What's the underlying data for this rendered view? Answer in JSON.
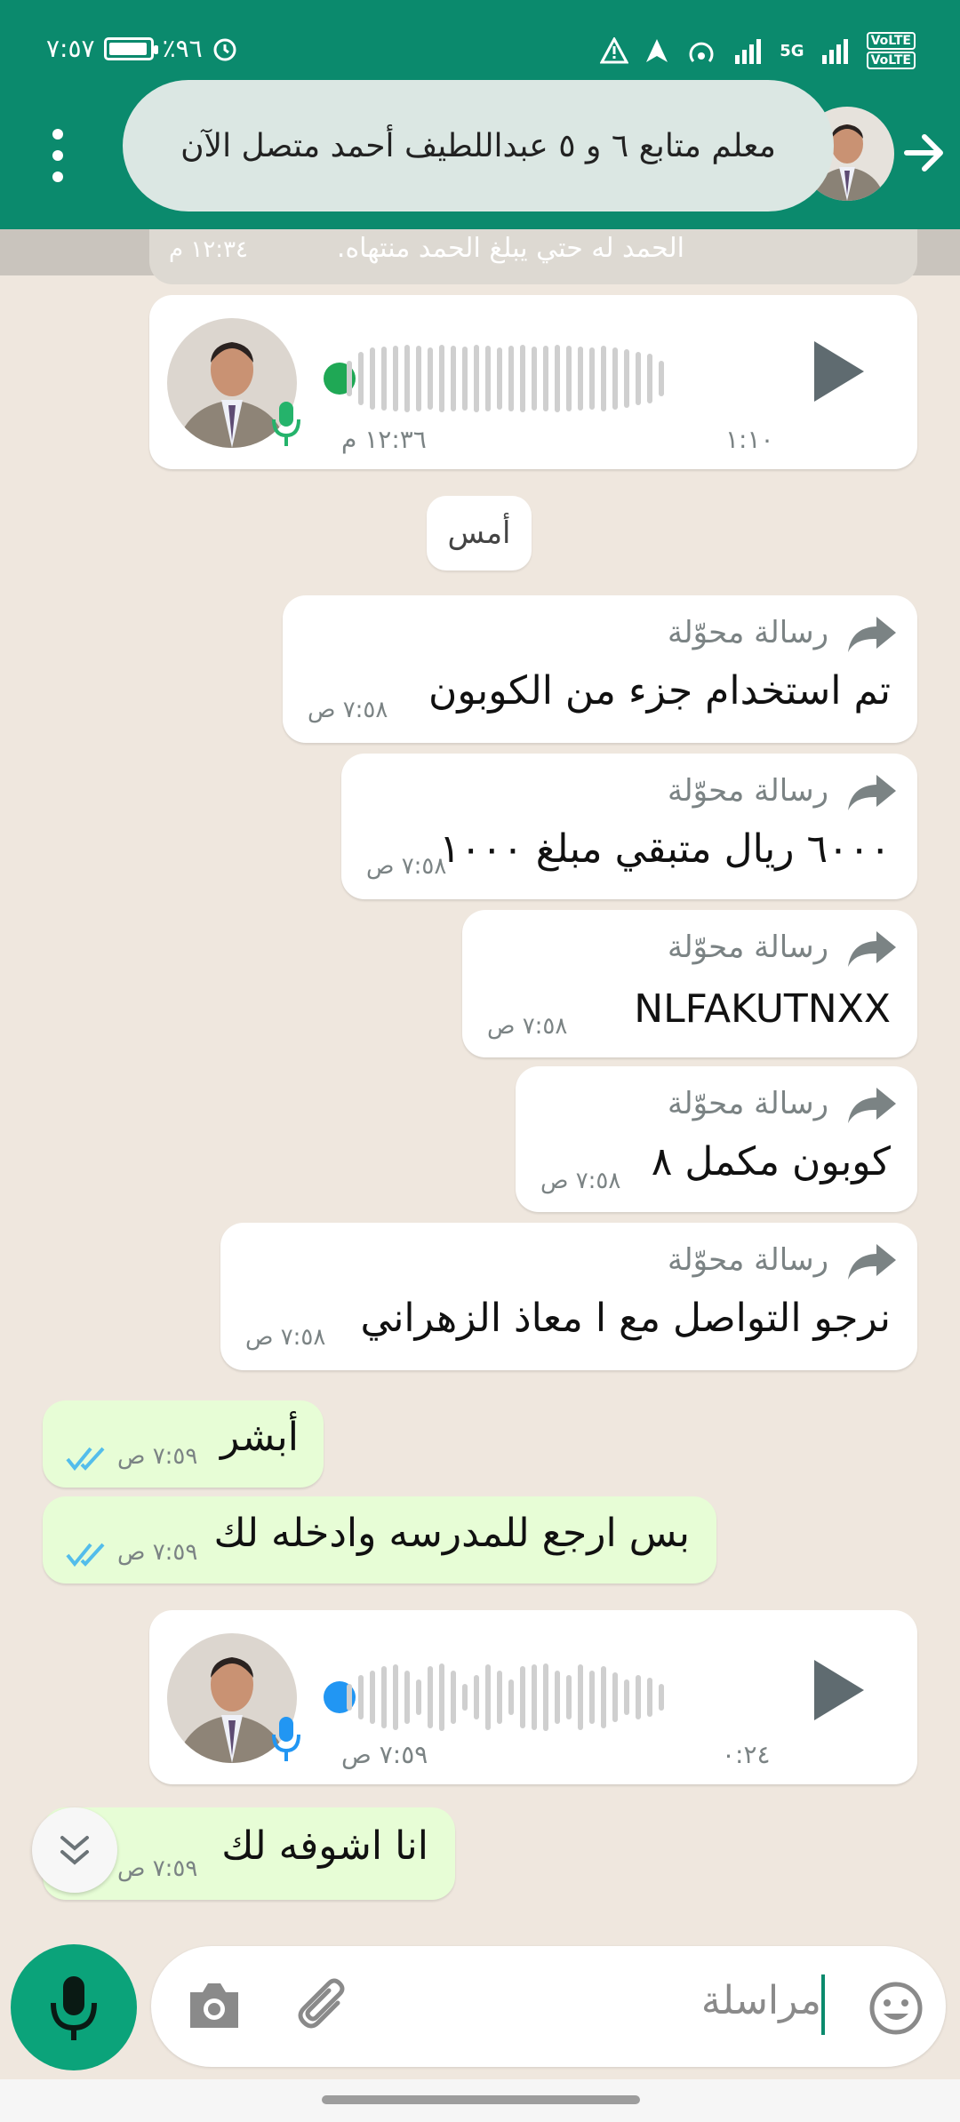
{
  "status_bar": {
    "time": "٧:٥٧",
    "battery": "٪٩٦",
    "battery_level": 0.96,
    "network": "5G",
    "volte": "VoLTE"
  },
  "header": {
    "banner_text": "معلم متابع ٦ و ٥ عبداللطيف أحمد متصل الآن"
  },
  "dim_message": {
    "text": "الحمد له حتي يبلغ الحمد منتهاه.",
    "time": "١٢:٣٤ م"
  },
  "voice_1": {
    "time": "١٢:٣٦ م",
    "duration": "١:١٠",
    "dot_color": "#1fa855"
  },
  "day_separator": "أمس",
  "forward_label": "رسالة محوّلة",
  "incoming": [
    {
      "text": "تم استخدام جزء من الكوبون",
      "time": "٧:٥٨ ص"
    },
    {
      "text": "٦٠٠٠ ريال متبقي مبلغ ١٠٠٠",
      "time": "٧:٥٨ ص"
    },
    {
      "text": "NLFAKUTNXX",
      "time": "٧:٥٨ ص"
    },
    {
      "text": "كوبون مكمل ٨",
      "time": "٧:٥٨ ص"
    },
    {
      "text": "نرجو التواصل مع ا معاذ الزهراني",
      "time": "٧:٥٨ ص"
    }
  ],
  "outgoing": [
    {
      "text": "أبشر",
      "time": "٧:٥٩ ص"
    },
    {
      "text": "بس ارجع للمدرسه وادخله لك",
      "time": "٧:٥٩ ص"
    },
    {
      "text": "انا اشوفه لك",
      "time": "٧:٥٩ ص"
    }
  ],
  "voice_2": {
    "time": "٧:٥٩ ص",
    "duration": "٠:٢٤",
    "dot_color": "#2196f3"
  },
  "composer": {
    "placeholder": "مراسلة"
  },
  "colors": {
    "header": "#0b8a6d",
    "mic": "#0ba37a",
    "outgoing_bubble": "#e7fdd6",
    "tick": "#53bdeb"
  }
}
